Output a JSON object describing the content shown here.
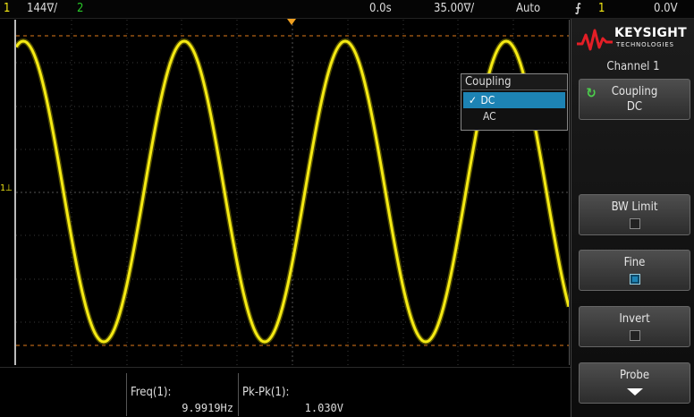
{
  "status_bar": {
    "ch1_number": "1",
    "ch1_scale": "144∇/",
    "ch2_number": "2",
    "time_position": "0.0s",
    "time_scale": "35.00∇/",
    "trigger_mode": "Auto",
    "trigger_icon": "⨍",
    "trigger_source": "1",
    "trigger_level": "0.0V"
  },
  "colors": {
    "channel1": "#f5ea14",
    "channel2": "#28c828",
    "trigger_marker": "#f0a020",
    "selection": "#1d83b4",
    "panel_bg": "#1c1c1c"
  },
  "screen": {
    "ground_marker": "1⊥",
    "trigger_marker_label": "T"
  },
  "waveform": {
    "shape": "sine",
    "cycles_visible": 3.6
  },
  "coupling_dropdown": {
    "title": "Coupling",
    "options": [
      "DC",
      "AC"
    ],
    "selected": "DC",
    "check": "✓"
  },
  "panel": {
    "brand": "KEYSIGHT",
    "brand_sub": "TECHNOLOGIES",
    "menu_title": "Channel 1",
    "softkeys": {
      "coupling_label": "Coupling",
      "coupling_value": "DC",
      "bw_limit_label": "BW Limit",
      "bw_limit_on": false,
      "fine_label": "Fine",
      "fine_on": true,
      "invert_label": "Invert",
      "invert_on": false,
      "probe_label": "Probe"
    }
  },
  "measurements": [
    {
      "label": "Freq(1):",
      "value": "9.9919Hz"
    },
    {
      "label": "Pk-Pk(1):",
      "value": "1.030V"
    }
  ]
}
